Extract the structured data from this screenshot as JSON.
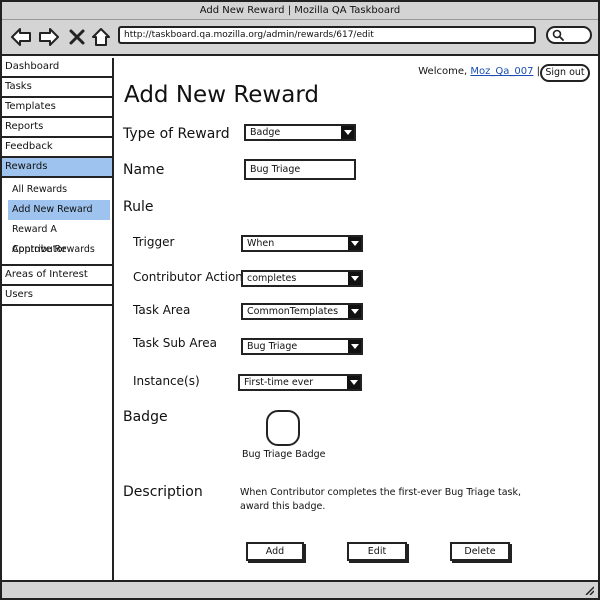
{
  "window": {
    "title": "Add New Reward | Mozilla QA Taskboard"
  },
  "browser": {
    "url": "http://taskboard.qa.mozilla.org/admin/rewards/617/edit"
  },
  "sidebar": {
    "items": [
      {
        "label": "Dashboard"
      },
      {
        "label": "Tasks"
      },
      {
        "label": "Templates"
      },
      {
        "label": "Reports"
      },
      {
        "label": "Feedback"
      },
      {
        "label": "Rewards"
      }
    ],
    "sub_items": [
      {
        "label": "All Rewards"
      },
      {
        "label": "Add New Reward"
      },
      {
        "label": "Reward A Contributor"
      },
      {
        "label": "Approve Rewards"
      }
    ],
    "bottom_items": [
      {
        "label": "Areas of Interest"
      },
      {
        "label": "Users"
      }
    ]
  },
  "header": {
    "welcome_text": "Welcome,",
    "username": "Moz_Qa_007",
    "separator": "|",
    "signout_label": "Sign out"
  },
  "form": {
    "title": "Add New Reward",
    "type_label": "Type of Reward",
    "type_value": "Badge",
    "name_label": "Name",
    "name_value": "Bug Triage",
    "rule_label": "Rule",
    "trigger_label": "Trigger",
    "trigger_value": "When",
    "action_label": "Contributor Action",
    "action_value": "completes",
    "area_label": "Task Area",
    "area_value": "CommonTemplates",
    "subarea_label": "Task Sub Area",
    "subarea_value": "Bug Triage",
    "instance_label": "Instance(s)",
    "instance_value": "First-time ever",
    "badge_label": "Badge",
    "badge_caption": "Bug Triage Badge",
    "description_label": "Description",
    "description_text": "When Contributor completes the first-ever Bug Triage task, award this badge."
  },
  "actions": {
    "add_label": "Add",
    "edit_label": "Edit",
    "delete_label": "Delete"
  }
}
